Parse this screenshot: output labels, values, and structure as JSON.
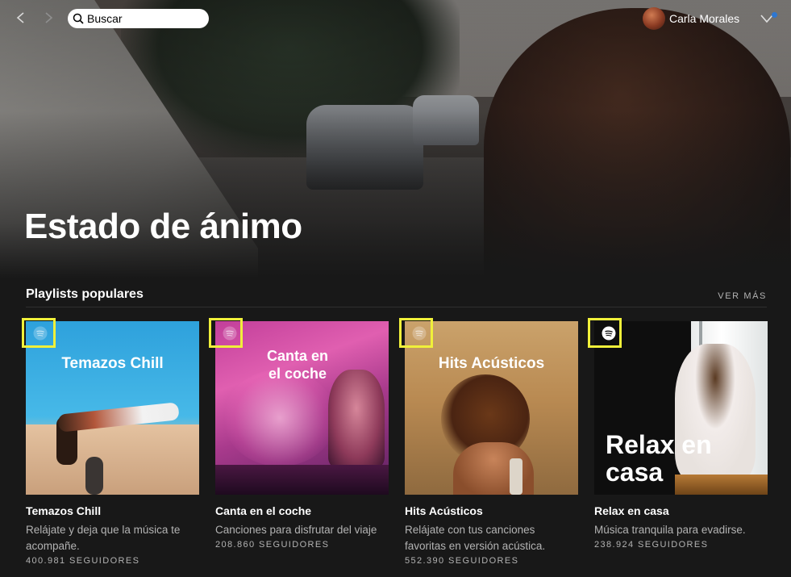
{
  "topbar": {
    "search_placeholder": "Buscar",
    "user_name": "Carla Morales"
  },
  "header": {
    "title": "Estado de ánimo"
  },
  "section": {
    "title": "Playlists populares",
    "see_more": "VER MÁS"
  },
  "playlists": [
    {
      "cover_title": "Temazos Chill",
      "title": "Temazos Chill",
      "description": "Relájate y deja que la música te acompañe.",
      "followers": "400.981 SEGUIDORES"
    },
    {
      "cover_title": "Canta en el coche",
      "title": "Canta en el coche",
      "description": "Canciones para disfrutar del viaje",
      "followers": "208.860 SEGUIDORES"
    },
    {
      "cover_title": "Hits Acústicos",
      "title": "Hits Acústicos",
      "description": "Relájate con tus canciones favoritas en versión acústica.",
      "followers": "552.390 SEGUIDORES"
    },
    {
      "cover_title": "Relax en casa",
      "title": "Relax en casa",
      "description": "Música tranquila para evadirse.",
      "followers": "238.924 SEGUIDORES"
    }
  ],
  "colors": {
    "background": "#181818",
    "text_secondary": "#b3b3b3",
    "highlight": "#f0f03a",
    "notification": "#2e77d0"
  },
  "icons": [
    "back-arrow-icon",
    "forward-arrow-icon",
    "search-icon",
    "chevron-down-icon",
    "spotify-logo-icon"
  ]
}
